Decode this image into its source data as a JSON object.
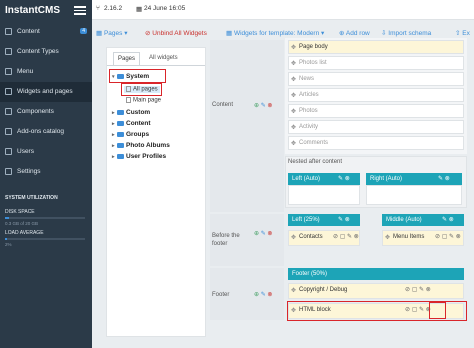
{
  "app": {
    "brand": "InstantCMS",
    "version": "2.16.2",
    "date": "24 June 16:05"
  },
  "toolbar": {
    "pages": "Pages",
    "unbind": "Unbind All Widgets",
    "template": "Widgets for template: Modern",
    "add_row": "Add row",
    "import": "Import schema",
    "export": "Ex"
  },
  "sidebar": {
    "items": [
      {
        "label": "Content",
        "badge": "4"
      },
      {
        "label": "Content Types"
      },
      {
        "label": "Menu"
      },
      {
        "label": "Widgets and pages"
      },
      {
        "label": "Components"
      },
      {
        "label": "Add-ons catalog"
      },
      {
        "label": "Users"
      },
      {
        "label": "Settings"
      }
    ],
    "util_title": "SYSTEM UTILIZATION",
    "disk_label": "DISK SPACE",
    "disk_value": "0.3 GB of 20 GB",
    "disk_fill": 0.05,
    "load_label": "LOAD AVERAGE",
    "load_value": "2%",
    "load_fill": 0.03
  },
  "tree": {
    "tabs": [
      "Pages",
      "All widgets"
    ],
    "system": "System",
    "all_pages": "All pages",
    "main_page": "Main page",
    "nodes": [
      "Custom",
      "Content",
      "Groups",
      "Photo Albums",
      "User Profiles"
    ]
  },
  "schema": {
    "row_content": "Content",
    "row_before_footer": "Before the footer",
    "row_footer": "Footer",
    "content_widgets": [
      "Page body",
      "Photos list",
      "News",
      "Articles",
      "Photos",
      "Activity",
      "Comments"
    ],
    "nested": "Nested after content",
    "left_auto": "Left (Auto)",
    "right_auto": "Right (Auto)",
    "left_25": "Left (25%)",
    "middle_auto": "Middle (Auto)",
    "contacts": "Contacts",
    "menu_items": "Menu Items",
    "footer_50": "Footer (50%)",
    "copyright": "Copyright / Debug",
    "html_block": "HTML block"
  }
}
